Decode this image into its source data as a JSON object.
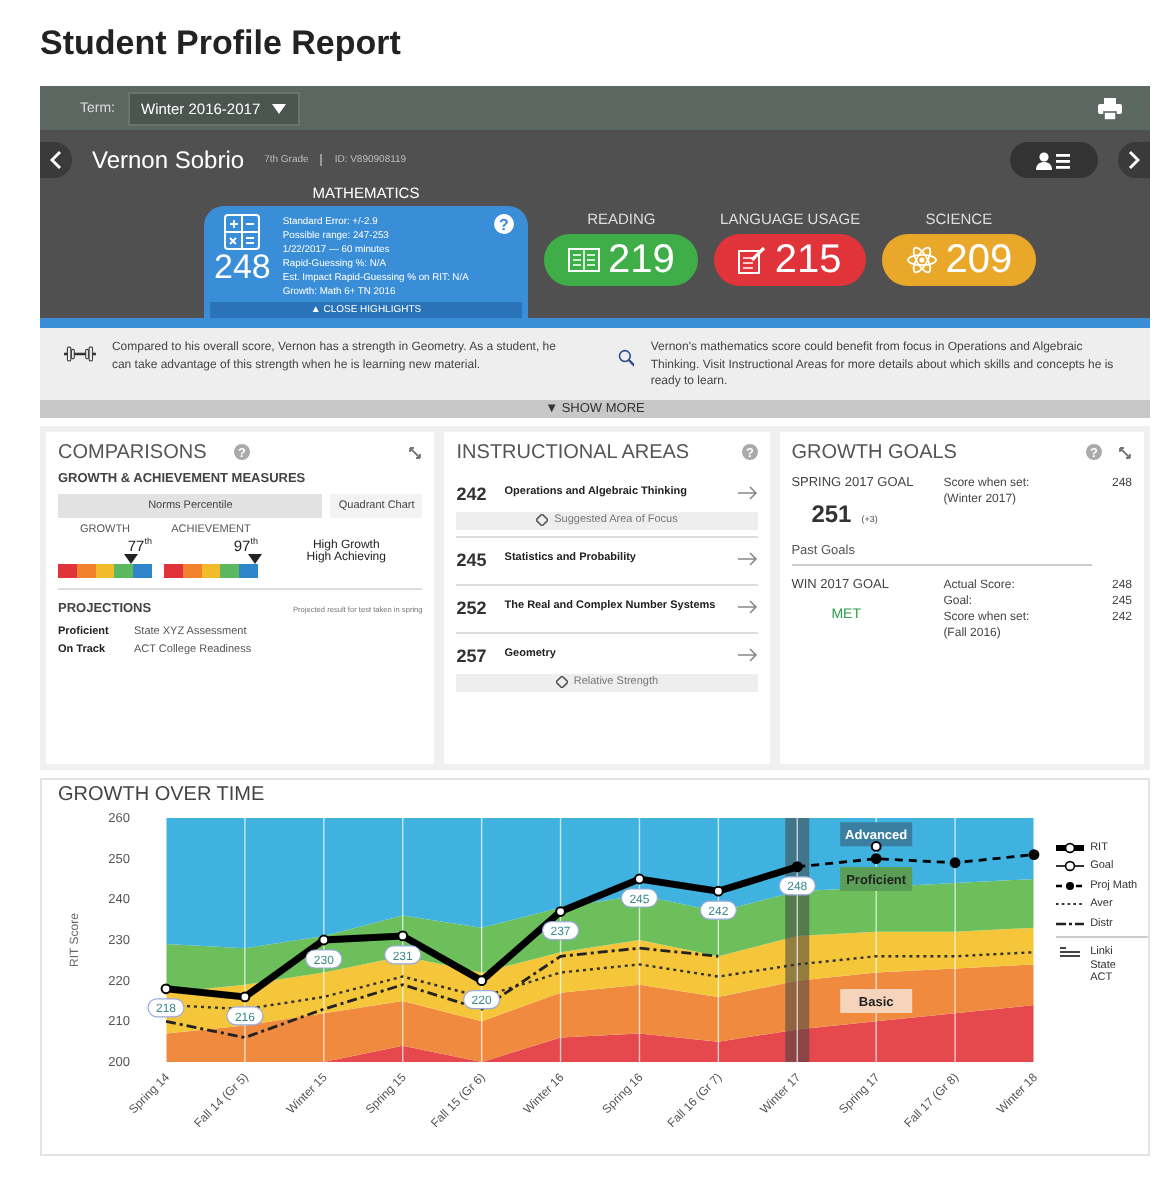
{
  "page_title": "Student Profile Report",
  "term": {
    "label": "Term:",
    "value": "Winter 2016-2017"
  },
  "student": {
    "name": "Vernon Sobrio",
    "grade": "7th Grade",
    "id": "ID: V890908119"
  },
  "highlight_subject": {
    "help": "?",
    "title": "MATHEMATICS",
    "score": "248",
    "details": [
      "Standard Error: +/-2.9",
      "Possible range: 247-253",
      "1/22/2017 — 60 minutes",
      "Rapid-Guessing %: N/A",
      "Est. Impact Rapid-Guessing % on RIT: N/A",
      "Growth: Math 6+ TN 2016"
    ],
    "close_label": "▲ CLOSE HIGHLIGHTS"
  },
  "subjects": [
    {
      "name": "READING",
      "score": "219",
      "kind": "book",
      "color": "#3fae49"
    },
    {
      "name": "LANGUAGE USAGE",
      "score": "215",
      "kind": "pencil",
      "color": "#e0333a"
    },
    {
      "name": "SCIENCE",
      "score": "209",
      "kind": "atom",
      "color": "#eaa82a"
    }
  ],
  "insights": [
    {
      "kind": "strength",
      "text": "Compared to his overall score, Vernon has a strength in Geometry. As a student, he can take advantage of this strength when he is learning new material."
    },
    {
      "kind": "focus",
      "text": "Vernon's mathematics score could benefit from focus in Operations and Algebraic Thinking. Visit Instructional Areas for more details about which skills and concepts he is ready to learn."
    }
  ],
  "show_more": "▼ SHOW MORE",
  "comparisons": {
    "title": "COMPARISONS",
    "help": "?",
    "subtitle": "GROWTH & ACHIEVEMENT MEASURES",
    "tabs": [
      {
        "label": "Norms Percentile",
        "selected": true
      },
      {
        "label": "Quadrant Chart",
        "selected": false
      }
    ],
    "measures": [
      {
        "label": "GROWTH",
        "percentile": "77",
        "suffix": "th",
        "level": 0.77
      },
      {
        "label": "ACHIEVEMENT",
        "percentile": "97",
        "suffix": "th",
        "level": 0.97
      }
    ],
    "quadrant": [
      "High Growth",
      "High Achieving"
    ],
    "projections": {
      "title": "PROJECTIONS",
      "note": "Projected result for test taken in spring",
      "rows": [
        {
          "status": "Proficient",
          "test": "State XYZ Assessment"
        },
        {
          "status": "On Track",
          "test": "ACT College Readiness"
        }
      ]
    }
  },
  "instructional_areas": {
    "title": "INSTRUCTIONAL AREAS",
    "help": "?",
    "items": [
      {
        "score": "242",
        "name": "Operations and Algebraic Thinking",
        "tag": "Suggested Area of Focus"
      },
      {
        "score": "245",
        "name": "Statistics and Probability"
      },
      {
        "score": "252",
        "name": "The Real and Complex Number Systems"
      },
      {
        "score": "257",
        "name": "Geometry",
        "tag": "Relative Strength"
      }
    ]
  },
  "growth_goals": {
    "title": "GROWTH GOALS",
    "help": "?",
    "current": {
      "title": "SPRING 2017 GOAL",
      "score": "251",
      "change": "(+3)",
      "set_label": "Score when set:",
      "set_value": "248",
      "set_term": "(Winter 2017)"
    },
    "past_title": "Past Goals",
    "past": [
      {
        "title": "WIN 2017 GOAL",
        "status": "MET",
        "met": true,
        "rows": [
          {
            "label": "Actual Score:",
            "value": "248"
          },
          {
            "label": "Goal:",
            "value": "245"
          },
          {
            "label": "Score when set:",
            "value": "242"
          }
        ],
        "set_term": "(Fall 2016)"
      }
    ]
  },
  "growth_over_time": {
    "title": "GROWTH OVER TIME",
    "chart_data": {
      "type": "line",
      "ylabel": "RIT Score",
      "categories": [
        "Spring 14",
        "Fall 14 (Gr 5)",
        "Winter 15",
        "Spring 15",
        "Fall 15 (Gr 6)",
        "Winter 16",
        "Spring 16",
        "Fall 16 (Gr 7)",
        "Winter 17",
        "Spring 17",
        "Fall 17 (Gr 8)",
        "Winter 18"
      ],
      "ylim": [
        200,
        260
      ],
      "yticks": [
        200,
        210,
        220,
        230,
        240,
        250,
        260
      ],
      "grid": true,
      "series": [
        {
          "name": "RIT",
          "color": "#000000",
          "line_style": "solid",
          "marker": "circle",
          "values": [
            218,
            216,
            230,
            231,
            220,
            237,
            245,
            242,
            248,
            null,
            null,
            null
          ],
          "value_labels": [
            "218",
            "216",
            "230",
            "231",
            "220",
            "237",
            "245",
            "242",
            "248",
            null,
            null,
            null
          ]
        },
        {
          "name": "Goal",
          "color": "#000000",
          "line_style": "none",
          "marker": "open_circle",
          "values": [
            null,
            null,
            null,
            null,
            null,
            null,
            null,
            null,
            null,
            253,
            null,
            null
          ]
        },
        {
          "name": "Proj Math",
          "color": "#000000",
          "line_style": "dashed",
          "marker": "dot",
          "values": [
            null,
            null,
            null,
            null,
            null,
            null,
            null,
            null,
            248,
            250,
            249,
            251
          ]
        },
        {
          "name": "Aver",
          "color": "#333333",
          "line_style": "dotted",
          "values": [
            214,
            213,
            216,
            221,
            216,
            222,
            224,
            221,
            224,
            226,
            226,
            227
          ]
        },
        {
          "name": "Distr",
          "color": "#222222",
          "line_style": "dashdot",
          "values": [
            210,
            206,
            213,
            219,
            213,
            226,
            228,
            226,
            null,
            null,
            null,
            null
          ]
        }
      ],
      "annotations": [
        {
          "text": "Advanced",
          "x": "Spring 17",
          "y": 256
        },
        {
          "text": "Proficient",
          "x": "Spring 17",
          "y": 245
        },
        {
          "text": "Basic",
          "x": "Spring 17",
          "y": 215
        }
      ]
    },
    "legend_extra": [
      "Linki",
      "State",
      "ACT"
    ]
  }
}
